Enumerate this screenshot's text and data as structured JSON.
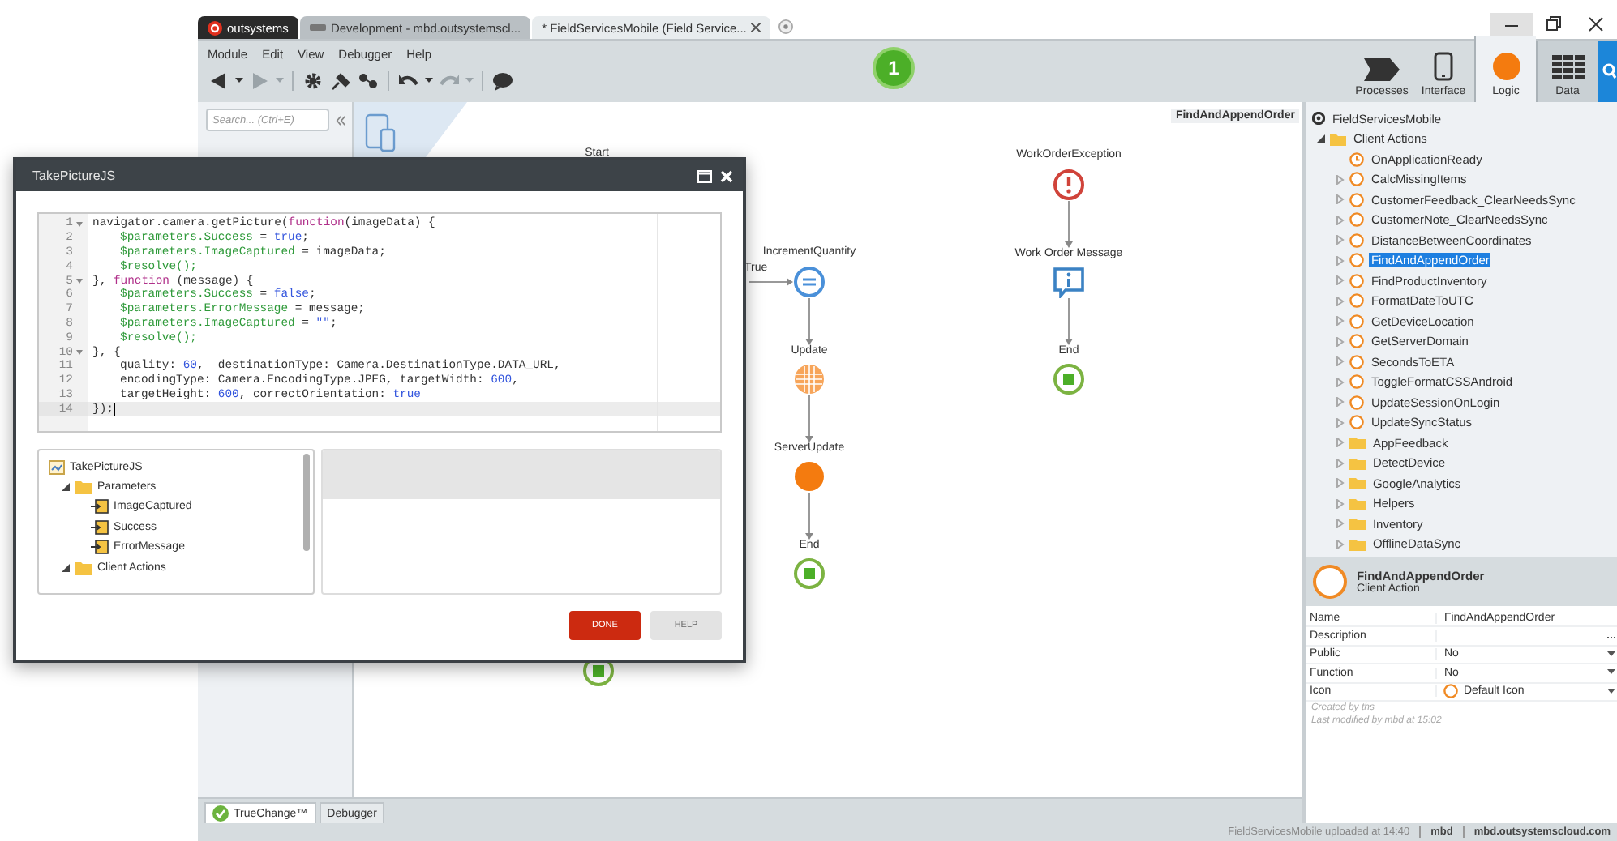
{
  "browser_tabs": [
    {
      "label": "outsystems",
      "kind": "brand",
      "selected": false
    },
    {
      "label": "Development - mbd.outsystemscl...",
      "kind": "page",
      "selected": false
    },
    {
      "label": "* FieldServicesMobile (Field Service...",
      "kind": "page",
      "selected": true
    }
  ],
  "menu": [
    "Module",
    "Edit",
    "View",
    "Debugger",
    "Help"
  ],
  "toolbar": [
    {
      "kind": "back",
      "disabled": false,
      "dropdown": true
    },
    {
      "kind": "forward",
      "disabled": true,
      "dropdown": true
    },
    {
      "kind": "gear",
      "disabled": false,
      "dropdown": false
    },
    {
      "kind": "plug",
      "disabled": false,
      "dropdown": false
    },
    {
      "kind": "dots",
      "disabled": false,
      "dropdown": false
    },
    {
      "kind": "undo",
      "disabled": false,
      "dropdown": true
    },
    {
      "kind": "redo",
      "disabled": true,
      "dropdown": true
    },
    {
      "kind": "chat",
      "disabled": false,
      "dropdown": false
    }
  ],
  "step_badge": "1",
  "app_tabs": [
    {
      "label": "Processes",
      "kind": "processes",
      "selected": false
    },
    {
      "label": "Interface",
      "kind": "interface",
      "selected": false
    },
    {
      "label": "Logic",
      "kind": "logic",
      "selected": true
    },
    {
      "label": "Data",
      "kind": "data",
      "selected": false
    }
  ],
  "left_panel": {
    "search": {
      "placeholder": "Search... (Ctrl+E)"
    }
  },
  "canvas": {
    "title": "FindAndAppendOrder",
    "nodes": [
      {
        "label": "Start",
        "kind": "start"
      },
      {
        "label": "IncrementQuantity",
        "kind": "assign",
        "incoming_label": "True"
      },
      {
        "label": "Update",
        "kind": "aggregate"
      },
      {
        "label": "ServerUpdate",
        "kind": "server"
      },
      {
        "label": "End",
        "kind": "end"
      },
      {
        "label": "WorkOrderException",
        "kind": "exception"
      },
      {
        "label": "Work Order Message",
        "kind": "message"
      },
      {
        "label": "End",
        "kind": "end"
      },
      {
        "kind": "end"
      }
    ]
  },
  "dialog": {
    "title": "TakePictureJS",
    "code_lines": [
      {
        "number": "1",
        "fold": true,
        "indented": false,
        "current": false,
        "tokens": [
          {
            "text": "navigator.camera.getPicture(",
            "kind": "plain"
          },
          {
            "text": "function",
            "kind": "keyword"
          },
          {
            "text": "(imageData) {",
            "kind": "plain"
          }
        ]
      },
      {
        "number": "2",
        "fold": false,
        "indented": true,
        "current": false,
        "tokens": [
          {
            "text": "$parameters.Success",
            "kind": "param"
          },
          {
            "text": " = ",
            "kind": "plain"
          },
          {
            "text": "true",
            "kind": "literal"
          },
          {
            "text": ";",
            "kind": "plain"
          }
        ]
      },
      {
        "number": "3",
        "fold": false,
        "indented": true,
        "current": false,
        "tokens": [
          {
            "text": "$parameters.ImageCaptured",
            "kind": "param"
          },
          {
            "text": " = imageData;",
            "kind": "plain"
          }
        ]
      },
      {
        "number": "4",
        "fold": false,
        "indented": true,
        "current": false,
        "tokens": [
          {
            "text": "$resolve();",
            "kind": "param"
          }
        ]
      },
      {
        "number": "5",
        "fold": true,
        "indented": false,
        "current": false,
        "tokens": [
          {
            "text": "}, ",
            "kind": "plain"
          },
          {
            "text": "function",
            "kind": "keyword"
          },
          {
            "text": " (message) {",
            "kind": "plain"
          }
        ]
      },
      {
        "number": "6",
        "fold": false,
        "indented": true,
        "current": false,
        "tokens": [
          {
            "text": "$parameters.Success",
            "kind": "param"
          },
          {
            "text": " = ",
            "kind": "plain"
          },
          {
            "text": "false",
            "kind": "literal"
          },
          {
            "text": ";",
            "kind": "plain"
          }
        ]
      },
      {
        "number": "7",
        "fold": false,
        "indented": true,
        "current": false,
        "tokens": [
          {
            "text": "$parameters.ErrorMessage",
            "kind": "param"
          },
          {
            "text": " = message;",
            "kind": "plain"
          }
        ]
      },
      {
        "number": "8",
        "fold": false,
        "indented": true,
        "current": false,
        "tokens": [
          {
            "text": "$parameters.ImageCaptured",
            "kind": "param"
          },
          {
            "text": " = ",
            "kind": "plain"
          },
          {
            "text": "\"\"",
            "kind": "string"
          },
          {
            "text": ";",
            "kind": "plain"
          }
        ]
      },
      {
        "number": "9",
        "fold": false,
        "indented": true,
        "current": false,
        "tokens": [
          {
            "text": "$resolve();",
            "kind": "param"
          }
        ]
      },
      {
        "number": "10",
        "fold": true,
        "indented": false,
        "current": false,
        "tokens": [
          {
            "text": "}, {",
            "kind": "plain"
          }
        ]
      },
      {
        "number": "11",
        "fold": false,
        "indented": true,
        "current": false,
        "tokens": [
          {
            "text": "quality: ",
            "kind": "plain"
          },
          {
            "text": "60",
            "kind": "literal"
          },
          {
            "text": ",  destinationType: Camera.DestinationType.DATA_URL,",
            "kind": "plain"
          }
        ]
      },
      {
        "number": "12",
        "fold": false,
        "indented": true,
        "current": false,
        "tokens": [
          {
            "text": "encodingType: Camera.EncodingType.JPEG, targetWidth: ",
            "kind": "plain"
          },
          {
            "text": "600",
            "kind": "literal"
          },
          {
            "text": ",",
            "kind": "plain"
          }
        ]
      },
      {
        "number": "13",
        "fold": false,
        "indented": true,
        "current": false,
        "tokens": [
          {
            "text": "targetHeight: ",
            "kind": "plain"
          },
          {
            "text": "600",
            "kind": "literal"
          },
          {
            "text": ", correctOrientation: ",
            "kind": "plain"
          },
          {
            "text": "true",
            "kind": "literal"
          }
        ]
      },
      {
        "number": "14",
        "fold": false,
        "indented": false,
        "current": true,
        "tokens": [
          {
            "text": "});",
            "kind": "plain"
          }
        ]
      }
    ],
    "tree": [
      {
        "label": "TakePictureJS",
        "kind": "action",
        "children": [
          {
            "label": "Parameters",
            "kind": "folder",
            "expanded": true,
            "children": [
              {
                "label": "ImageCaptured",
                "kind": "param"
              },
              {
                "label": "Success",
                "kind": "param"
              },
              {
                "label": "ErrorMessage",
                "kind": "param"
              }
            ]
          },
          {
            "label": "Client Actions",
            "kind": "folder",
            "expanded": true
          }
        ]
      }
    ],
    "buttons": [
      {
        "label": "DONE",
        "kind": "primary"
      },
      {
        "label": "HELP",
        "kind": "secondary"
      }
    ]
  },
  "bottom_tabs": [
    {
      "label": "TrueChange™",
      "kind": "status",
      "selected": true
    },
    {
      "label": "Debugger",
      "kind": "plain",
      "selected": false
    }
  ],
  "right_panel": {
    "tree": {
      "root": "FieldServicesMobile",
      "items": [
        {
          "label": "Client Actions",
          "kind": "folder",
          "expanded": true,
          "children": [
            {
              "label": "OnApplicationReady",
              "kind": "event",
              "expander": false,
              "selected": false
            },
            {
              "label": "CalcMissingItems",
              "kind": "action",
              "expander": true,
              "selected": false
            },
            {
              "label": "CustomerFeedback_ClearNeedsSync",
              "kind": "action",
              "expander": true,
              "selected": false
            },
            {
              "label": "CustomerNote_ClearNeedsSync",
              "kind": "action",
              "expander": true,
              "selected": false
            },
            {
              "label": "DistanceBetweenCoordinates",
              "kind": "action",
              "expander": true,
              "selected": false
            },
            {
              "label": "FindAndAppendOrder",
              "kind": "action",
              "expander": true,
              "selected": true
            },
            {
              "label": "FindProductInventory",
              "kind": "action",
              "expander": true,
              "selected": false
            },
            {
              "label": "FormatDateToUTC",
              "kind": "action",
              "expander": true,
              "selected": false
            },
            {
              "label": "GetDeviceLocation",
              "kind": "action",
              "expander": true,
              "selected": false
            },
            {
              "label": "GetServerDomain",
              "kind": "action",
              "expander": true,
              "selected": false
            },
            {
              "label": "SecondsToETA",
              "kind": "action",
              "expander": true,
              "selected": false
            },
            {
              "label": "ToggleFormatCSSAndroid",
              "kind": "action",
              "expander": true,
              "selected": false
            },
            {
              "label": "UpdateSessionOnLogin",
              "kind": "action",
              "expander": true,
              "selected": false
            },
            {
              "label": "UpdateSyncStatus",
              "kind": "action",
              "expander": true,
              "selected": false
            },
            {
              "label": "AppFeedback",
              "kind": "folder",
              "expander": true,
              "selected": false
            },
            {
              "label": "DetectDevice",
              "kind": "folder",
              "expander": true,
              "selected": false
            },
            {
              "label": "GoogleAnalytics",
              "kind": "folder",
              "expander": true,
              "selected": false
            },
            {
              "label": "Helpers",
              "kind": "folder",
              "expander": true,
              "selected": false
            },
            {
              "label": "Inventory",
              "kind": "folder",
              "expander": true,
              "selected": false
            },
            {
              "label": "OfflineDataSync",
              "kind": "folder",
              "expander": true,
              "selected": false
            }
          ]
        }
      ]
    },
    "properties": {
      "title": "FindAndAppendOrder",
      "subtitle": "Client Action",
      "rows": [
        {
          "name": "Name",
          "value": "FindAndAppendOrder",
          "kind": "text"
        },
        {
          "name": "Description",
          "kind": "multiline"
        },
        {
          "name": "Public",
          "value": "No",
          "kind": "dropdown"
        },
        {
          "name": "Function",
          "value": "No",
          "kind": "dropdown"
        },
        {
          "name": "Icon",
          "value": "Default Icon",
          "kind": "icon"
        }
      ],
      "notes": [
        "Created by ths",
        "Last modified by mbd at 15:02"
      ]
    }
  },
  "status_bar": {
    "message": "FieldServicesMobile uploaded at 14:40",
    "user": "mbd",
    "server": "mbd.outsystemscloud.com"
  }
}
